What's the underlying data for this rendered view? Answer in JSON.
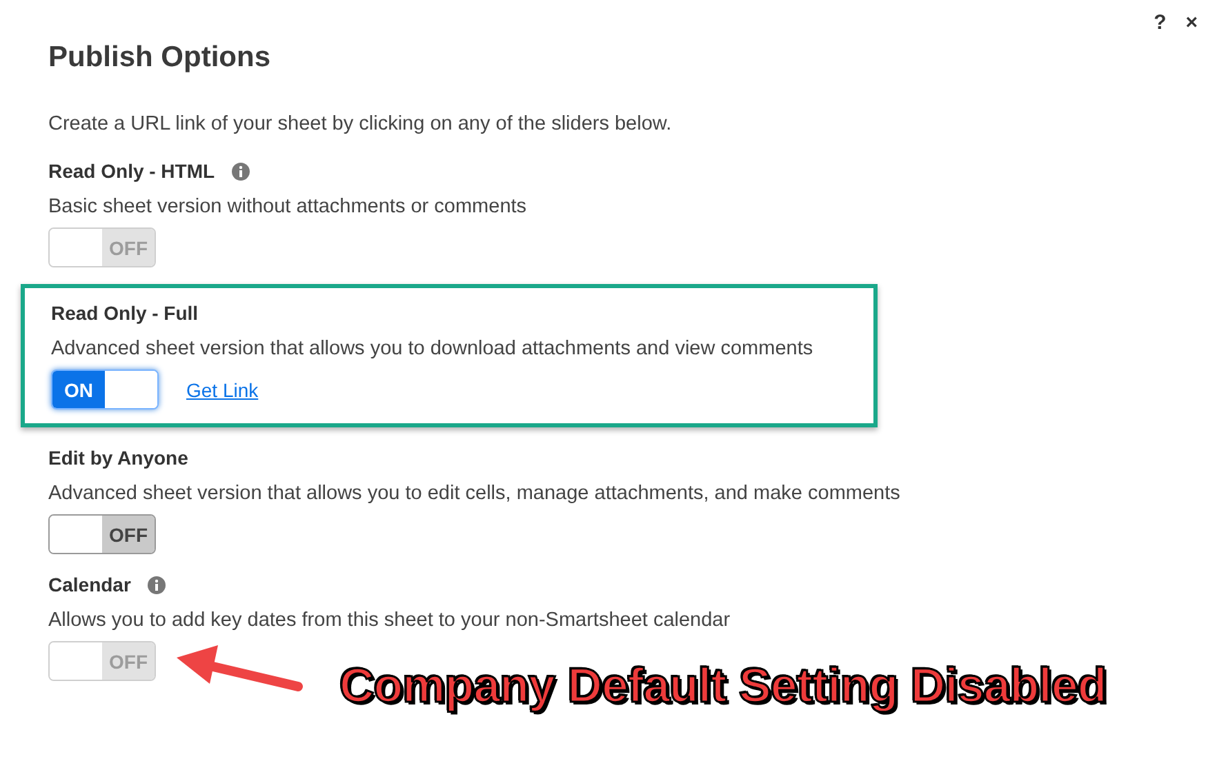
{
  "dialog": {
    "title": "Publish Options",
    "help_button": "?",
    "close_button": "×",
    "intro": "Create a URL link of your sheet by clicking on any of the sliders below."
  },
  "options": [
    {
      "title": "Read Only - HTML",
      "info": true,
      "description": "Basic sheet version without attachments or comments",
      "toggle": {
        "label": "OFF",
        "on": false,
        "disabled": true
      },
      "highlighted": false
    },
    {
      "title": "Read Only - Full",
      "info": false,
      "description": "Advanced sheet version that allows you to download attachments and view comments",
      "toggle": {
        "label": "ON",
        "on": true,
        "disabled": false
      },
      "link": "Get Link",
      "highlighted": true
    },
    {
      "title": "Edit by Anyone",
      "info": false,
      "description": "Advanced sheet version that allows you to edit cells, manage attachments, and make comments",
      "toggle": {
        "label": "OFF",
        "on": false,
        "disabled": false
      },
      "highlighted": false
    },
    {
      "title": "Calendar",
      "info": true,
      "description": "Allows you to add key dates from this sheet to your non-Smartsheet calendar",
      "toggle": {
        "label": "OFF",
        "on": false,
        "disabled": true
      },
      "highlighted": false
    }
  ],
  "annotation": {
    "text": "Company Default Setting Disabled"
  }
}
